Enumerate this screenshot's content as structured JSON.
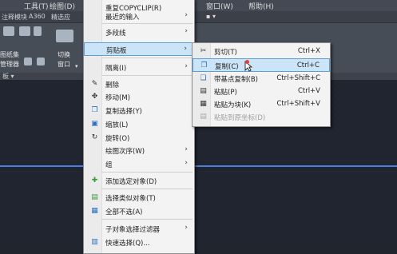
{
  "menubar": {
    "items": [
      "工具(T)",
      "绘图(D)",
      "窗口(W)",
      "帮助(H)"
    ]
  },
  "tabbar": {
    "items": [
      "注释模块",
      "A360",
      "精选应"
    ]
  },
  "ribbon": {
    "labels": [
      "图纸集",
      "管理器",
      "切换",
      "窗口"
    ],
    "panel_label": "板 ▾"
  },
  "context_menu": {
    "top_items": [
      "重复COPYCLIP(R)",
      "最近的输入"
    ],
    "items": [
      {
        "label": "多段线",
        "icon": "",
        "submenu": true
      },
      {
        "label": "剪贴板",
        "icon": "",
        "submenu": true,
        "highlight": true
      },
      {
        "label": "隔离(I)",
        "icon": "",
        "submenu": true
      },
      {
        "label": "删除",
        "icon": "eraser-icon"
      },
      {
        "label": "移动(M)",
        "icon": "move-icon"
      },
      {
        "label": "复制选择(Y)",
        "icon": "copy-select-icon"
      },
      {
        "label": "缩放(L)",
        "icon": "scale-icon"
      },
      {
        "label": "旋转(O)",
        "icon": "rotate-icon"
      },
      {
        "label": "绘图次序(W)",
        "icon": "",
        "submenu": true
      },
      {
        "label": "组",
        "icon": "",
        "submenu": true
      },
      {
        "label": "添加选定对象(D)",
        "icon": "add-selected-icon"
      },
      {
        "label": "选择类似对象(T)",
        "icon": "select-similar-icon"
      },
      {
        "label": "全部不选(A)",
        "icon": "deselect-icon"
      },
      {
        "label": "子对象选择过滤器",
        "icon": "",
        "submenu": true
      },
      {
        "label": "快速选择(Q)...",
        "icon": "quick-select-icon"
      }
    ]
  },
  "clipboard_menu": {
    "items": [
      {
        "label": "剪切(T)",
        "shortcut": "Ctrl+X",
        "icon": "cut-icon"
      },
      {
        "label": "复制(C)",
        "shortcut": "Ctrl+C",
        "icon": "copy-icon",
        "highlight": true
      },
      {
        "label": "带基点复制(B)",
        "shortcut": "Ctrl+Shift+C",
        "icon": "copy-base-icon"
      },
      {
        "label": "粘贴(P)",
        "shortcut": "Ctrl+V",
        "icon": "paste-icon"
      },
      {
        "label": "粘贴为块(K)",
        "shortcut": "Ctrl+Shift+V",
        "icon": "paste-block-icon"
      },
      {
        "label": "粘贴到原坐标(D)",
        "shortcut": "",
        "icon": "paste-orig-icon",
        "disabled": true
      }
    ]
  },
  "icons": {
    "arrow": "›"
  }
}
